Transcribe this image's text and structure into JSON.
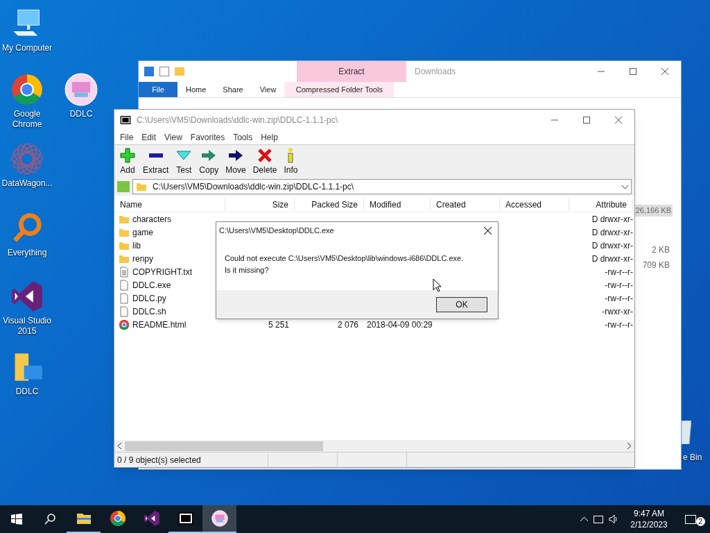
{
  "desktop_icons": [
    {
      "label": "My Computer",
      "kind": "computer"
    },
    {
      "label": "Google Chrome",
      "kind": "chrome"
    },
    {
      "label": "DDLC",
      "kind": "ddlc"
    },
    {
      "label": "DataWagon...",
      "kind": "datawagon"
    },
    {
      "label": "Everything",
      "kind": "everything"
    },
    {
      "label": "Visual Studio 2015",
      "kind": "vs"
    },
    {
      "label": "DDLC",
      "kind": "folder"
    },
    {
      "label": "e Bin",
      "kind": "bin"
    }
  ],
  "explorer": {
    "title": "Downloads",
    "context_tab": "Extract",
    "tabs": [
      {
        "label": "File",
        "selected": true
      },
      {
        "label": "Home",
        "selected": false
      },
      {
        "label": "Share",
        "selected": false
      },
      {
        "label": "View",
        "selected": false
      },
      {
        "label": "Compressed Folder Tools",
        "selected": false
      }
    ],
    "sizes": [
      "26,166 KB",
      "2 KB",
      "709 KB"
    ]
  },
  "sevenzip": {
    "title": "C:\\Users\\VM5\\Downloads\\ddlc-win.zip\\DDLC-1.1.1-pc\\",
    "menu": [
      "File",
      "Edit",
      "View",
      "Favorites",
      "Tools",
      "Help"
    ],
    "toolbar": [
      {
        "label": "Add",
        "kind": "add"
      },
      {
        "label": "Extract",
        "kind": "extract"
      },
      {
        "label": "Test",
        "kind": "test"
      },
      {
        "label": "Copy",
        "kind": "copy"
      },
      {
        "label": "Move",
        "kind": "move"
      },
      {
        "label": "Delete",
        "kind": "delete"
      },
      {
        "label": "Info",
        "kind": "info"
      }
    ],
    "path": "C:\\Users\\VM5\\Downloads\\ddlc-win.zip\\DDLC-1.1.1-pc\\",
    "columns": [
      "Name",
      "Size",
      "Packed Size",
      "Modified",
      "Created",
      "Accessed",
      "Attribute"
    ],
    "rows": [
      {
        "name": "characters",
        "kind": "folder",
        "attributes": "D drwxr-xr-"
      },
      {
        "name": "game",
        "kind": "folder",
        "attributes": "D drwxr-xr-"
      },
      {
        "name": "lib",
        "kind": "folder",
        "attributes": "D drwxr-xr-"
      },
      {
        "name": "renpy",
        "kind": "folder",
        "attributes": "D drwxr-xr-"
      },
      {
        "name": "COPYRIGHT.txt",
        "kind": "text",
        "attributes": "-rw-r--r-"
      },
      {
        "name": "DDLC.exe",
        "kind": "file",
        "attributes": "-rw-r--r-"
      },
      {
        "name": "DDLC.py",
        "kind": "file",
        "attributes": "-rw-r--r-"
      },
      {
        "name": "DDLC.sh",
        "kind": "file",
        "attributes": "-rwxr-xr-"
      },
      {
        "name": "README.html",
        "kind": "html",
        "size": "5 251",
        "packed_size": "2 076",
        "modified": "2018-04-09 00:29",
        "attributes": "-rw-r--r-"
      }
    ],
    "status": "0 / 9 object(s) selected"
  },
  "dialog": {
    "title": "C:\\Users\\VM5\\Desktop\\DDLC.exe",
    "lines": [
      "Could not execute C:\\Users\\VM5\\Desktop\\lib\\windows-i686\\DDLC.exe.",
      "Is it missing?"
    ],
    "button": "OK"
  },
  "taskbar": {
    "apps": [
      {
        "kind": "explorer",
        "running": true,
        "active": false
      },
      {
        "kind": "chrome",
        "running": false,
        "active": false
      },
      {
        "kind": "vs",
        "running": false,
        "active": false
      },
      {
        "kind": "sevenzip",
        "running": true,
        "active": false
      },
      {
        "kind": "ddlc",
        "running": true,
        "active": true
      }
    ],
    "time": "9:47 AM",
    "date": "2/12/2023",
    "notifications": "2"
  }
}
